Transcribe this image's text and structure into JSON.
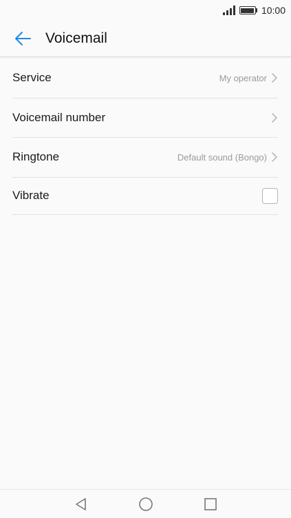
{
  "status_bar": {
    "time": "10:00"
  },
  "app_bar": {
    "title": "Voicemail"
  },
  "settings": [
    {
      "label": "Service",
      "value": "My operator"
    },
    {
      "label": "Voicemail number",
      "value": ""
    },
    {
      "label": "Ringtone",
      "value": "Default sound (Bongo)"
    },
    {
      "label": "Vibrate",
      "checked": false
    }
  ],
  "colors": {
    "accent": "#1e88e5"
  }
}
